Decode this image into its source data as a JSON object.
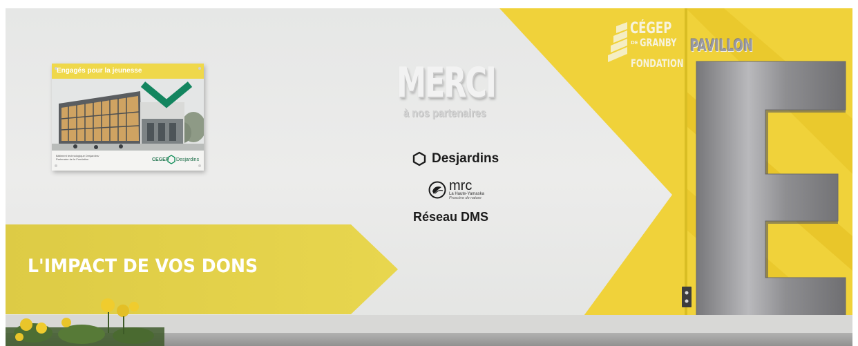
{
  "banner": {
    "title": "L'IMPACT DE VOS DONS"
  },
  "plaque": {
    "title": "Engagés pour la jeunesse",
    "footer_text": "Bâtiment technologique Desjardins · Partenaire de la Fondation",
    "brand_cegep": "CEGEP",
    "brand_desjardins": "Desjardins"
  },
  "merci": {
    "title": "MERCI",
    "subtitle": "à nos partenaires"
  },
  "partners": {
    "desjardins": "Desjardins",
    "mrc_name": "mrc",
    "mrc_region": "La Haute-Yamaska",
    "mrc_tagline": "Proscère de nature",
    "dms": "Réseau DMS"
  },
  "fondation": {
    "cegep": "CÉGEP",
    "de": "DE",
    "granby": "GRANBY",
    "fondation": "FONDATION"
  },
  "pavillon": {
    "label": "PAVILLON",
    "letter": "E"
  },
  "colors": {
    "accent_yellow": "#f0d23a",
    "banner_yellow": "#e3d048",
    "wall": "#e9e9e8",
    "metal": "#9c9c9e",
    "desjardins_green": "#00874e"
  }
}
